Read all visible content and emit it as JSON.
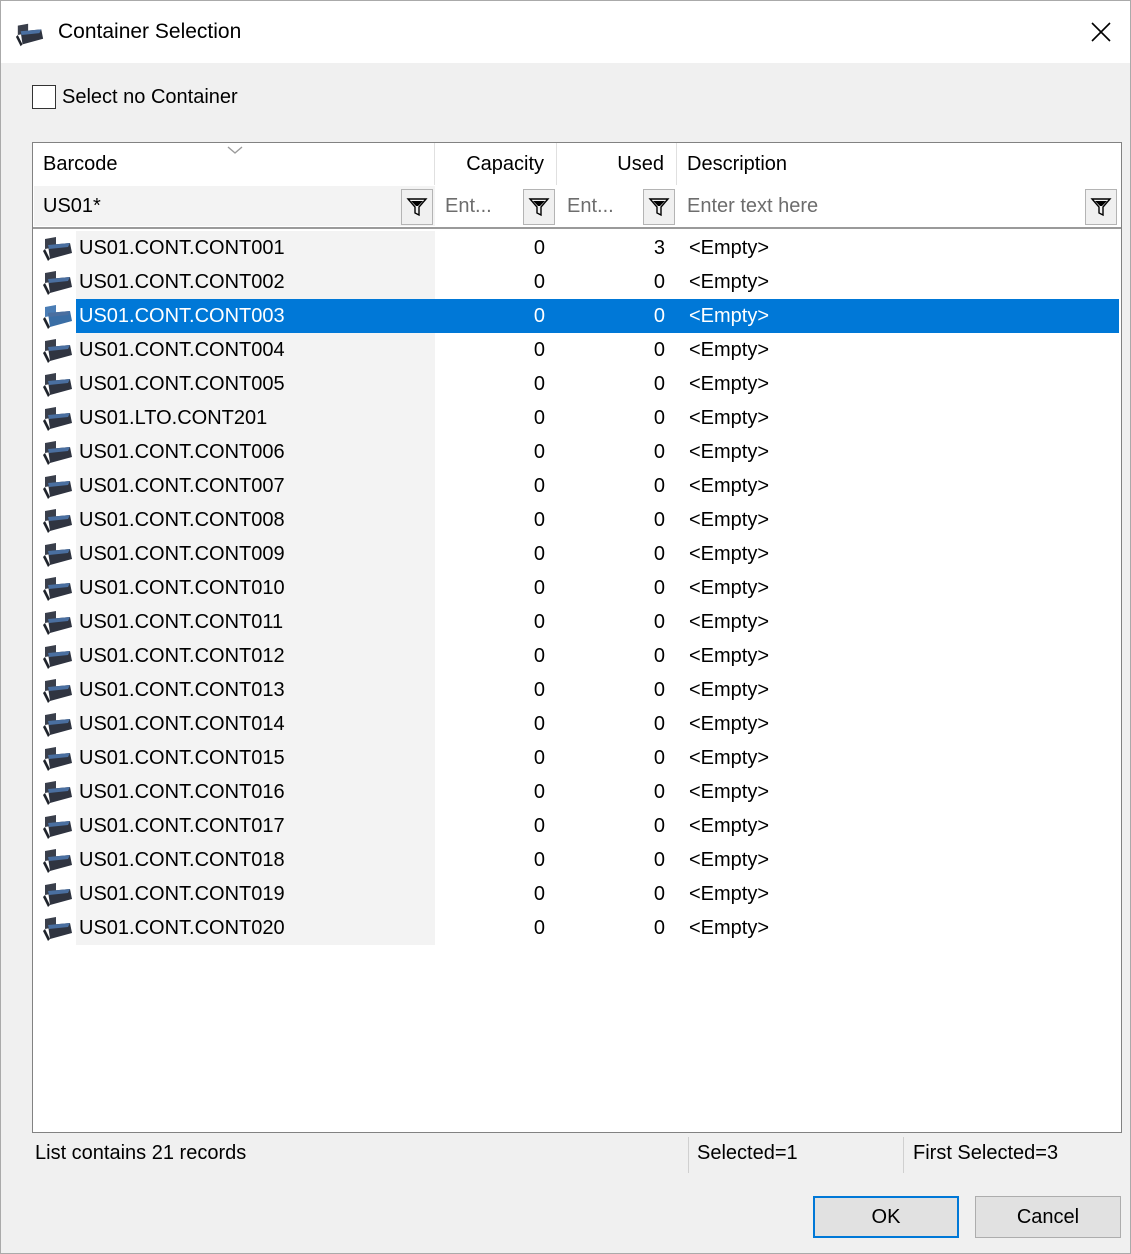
{
  "window": {
    "title": "Container Selection"
  },
  "select_no_container": {
    "label": "Select no Container",
    "checked": false
  },
  "grid": {
    "columns": {
      "barcode": "Barcode",
      "capacity": "Capacity",
      "used": "Used",
      "description": "Description"
    },
    "filters": {
      "barcode_value": "US01*",
      "capacity_placeholder": "Ent...",
      "used_placeholder": "Ent...",
      "description_placeholder": "Enter text here"
    },
    "rows": [
      {
        "barcode": "US01.CONT.CONT001",
        "capacity": "0",
        "used": "3",
        "description": "<Empty>"
      },
      {
        "barcode": "US01.CONT.CONT002",
        "capacity": "0",
        "used": "0",
        "description": "<Empty>"
      },
      {
        "barcode": "US01.CONT.CONT003",
        "capacity": "0",
        "used": "0",
        "description": "<Empty>",
        "selected": true
      },
      {
        "barcode": "US01.CONT.CONT004",
        "capacity": "0",
        "used": "0",
        "description": "<Empty>"
      },
      {
        "barcode": "US01.CONT.CONT005",
        "capacity": "0",
        "used": "0",
        "description": "<Empty>"
      },
      {
        "barcode": "US01.LTO.CONT201",
        "capacity": "0",
        "used": "0",
        "description": "<Empty>"
      },
      {
        "barcode": "US01.CONT.CONT006",
        "capacity": "0",
        "used": "0",
        "description": "<Empty>"
      },
      {
        "barcode": "US01.CONT.CONT007",
        "capacity": "0",
        "used": "0",
        "description": "<Empty>"
      },
      {
        "barcode": "US01.CONT.CONT008",
        "capacity": "0",
        "used": "0",
        "description": "<Empty>"
      },
      {
        "barcode": "US01.CONT.CONT009",
        "capacity": "0",
        "used": "0",
        "description": "<Empty>"
      },
      {
        "barcode": "US01.CONT.CONT010",
        "capacity": "0",
        "used": "0",
        "description": "<Empty>"
      },
      {
        "barcode": "US01.CONT.CONT011",
        "capacity": "0",
        "used": "0",
        "description": "<Empty>"
      },
      {
        "barcode": "US01.CONT.CONT012",
        "capacity": "0",
        "used": "0",
        "description": "<Empty>"
      },
      {
        "barcode": "US01.CONT.CONT013",
        "capacity": "0",
        "used": "0",
        "description": "<Empty>"
      },
      {
        "barcode": "US01.CONT.CONT014",
        "capacity": "0",
        "used": "0",
        "description": "<Empty>"
      },
      {
        "barcode": "US01.CONT.CONT015",
        "capacity": "0",
        "used": "0",
        "description": "<Empty>"
      },
      {
        "barcode": "US01.CONT.CONT016",
        "capacity": "0",
        "used": "0",
        "description": "<Empty>"
      },
      {
        "barcode": "US01.CONT.CONT017",
        "capacity": "0",
        "used": "0",
        "description": "<Empty>"
      },
      {
        "barcode": "US01.CONT.CONT018",
        "capacity": "0",
        "used": "0",
        "description": "<Empty>"
      },
      {
        "barcode": "US01.CONT.CONT019",
        "capacity": "0",
        "used": "0",
        "description": "<Empty>"
      },
      {
        "barcode": "US01.CONT.CONT020",
        "capacity": "0",
        "used": "0",
        "description": "<Empty>"
      }
    ]
  },
  "status": {
    "records": "List contains 21 records",
    "selected": "Selected=1",
    "first_selected": "First Selected=3"
  },
  "buttons": {
    "ok": "OK",
    "cancel": "Cancel"
  },
  "icons": {
    "title": "container-icon",
    "row": "container-icon",
    "filter": "filter-funnel-icon",
    "close": "close-icon",
    "sort": "sort-indicator-icon"
  },
  "colors": {
    "selection": "#0078d7",
    "icon_dark": "#3a3f4b",
    "icon_blue": "#2b6fb0"
  }
}
